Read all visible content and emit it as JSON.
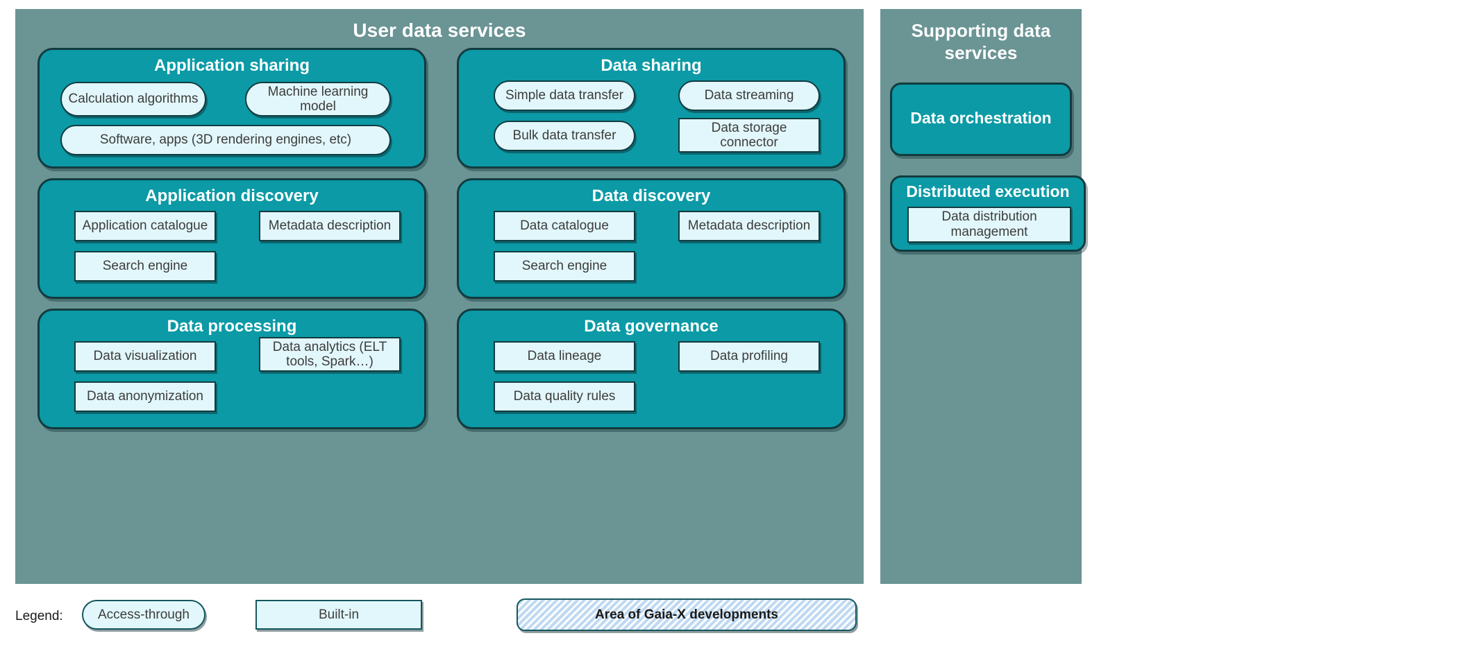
{
  "legend": {
    "label": "Legend:",
    "access_through": "Access-through",
    "built_in": "Built-in",
    "area": "Area of Gaia-X developments"
  },
  "colors": {
    "panel_background": "#6b9494",
    "group_fill": "#0b9aa6",
    "group_border": "#123b3f",
    "item_fill": "#e2f7fb",
    "item_text": "#3c3c3c",
    "title_text": "#ffffff",
    "legend_hatch": "#bed9f2"
  },
  "user_panel": {
    "title": "User data services",
    "groups": [
      {
        "title": "Application sharing",
        "items": [
          {
            "label": "Calculation algorithms",
            "shape": "pill"
          },
          {
            "label": "Machine learning model",
            "shape": "pill"
          },
          {
            "label": "Software, apps (3D rendering engines, etc)",
            "shape": "pill"
          }
        ]
      },
      {
        "title": "Data sharing",
        "items": [
          {
            "label": "Simple data transfer",
            "shape": "pill"
          },
          {
            "label": "Data streaming",
            "shape": "pill"
          },
          {
            "label": "Bulk data transfer",
            "shape": "pill"
          },
          {
            "label": "Data storage connector",
            "shape": "rect"
          }
        ]
      },
      {
        "title": "Application discovery",
        "items": [
          {
            "label": "Application catalogue",
            "shape": "rect"
          },
          {
            "label": "Metadata description",
            "shape": "rect"
          },
          {
            "label": "Search engine",
            "shape": "rect"
          }
        ]
      },
      {
        "title": "Data discovery",
        "items": [
          {
            "label": "Data catalogue",
            "shape": "rect"
          },
          {
            "label": "Metadata description",
            "shape": "rect"
          },
          {
            "label": "Search engine",
            "shape": "rect"
          }
        ]
      },
      {
        "title": "Data processing",
        "items": [
          {
            "label": "Data visualization",
            "shape": "rect"
          },
          {
            "label": "Data analytics (ELT tools, Spark…)",
            "shape": "rect"
          },
          {
            "label": "Data anonymization",
            "shape": "rect"
          }
        ]
      },
      {
        "title": "Data governance",
        "items": [
          {
            "label": "Data lineage",
            "shape": "rect"
          },
          {
            "label": "Data profiling",
            "shape": "rect"
          },
          {
            "label": "Data quality rules",
            "shape": "rect"
          }
        ]
      }
    ]
  },
  "supporting_panel": {
    "title": "Supporting data services",
    "groups": [
      {
        "title": "Data orchestration",
        "items": []
      },
      {
        "title": "Distributed execution",
        "items": [
          {
            "label": "Data distribution management",
            "shape": "rect"
          }
        ]
      }
    ]
  }
}
